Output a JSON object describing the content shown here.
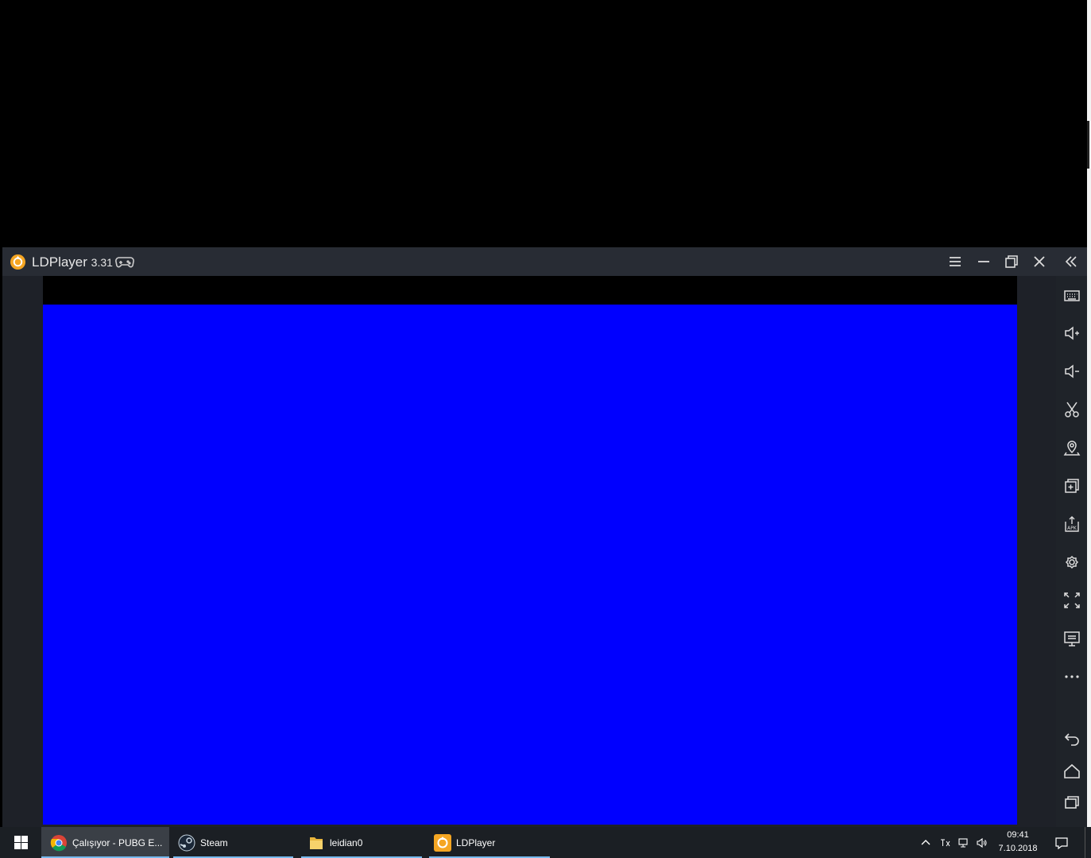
{
  "window": {
    "app_name": "LDPlayer",
    "version": "3.31",
    "menu_icon": "hamburger-icon",
    "minimize_icon": "minimize-icon",
    "restore_icon": "restore-icon",
    "close_icon": "close-icon",
    "collapse_icon": "double-chevron-left-icon"
  },
  "screen": {
    "content_color": "#0000ff",
    "letterbox_color": "#000000"
  },
  "side_toolbar": {
    "items": [
      "keyboard-icon",
      "volume-up-icon",
      "volume-down-icon",
      "screenshot-scissors-icon",
      "location-icon",
      "multi-instance-icon",
      "install-apk-icon",
      "settings-icon",
      "fullscreen-icon",
      "display-icon",
      "more-icon",
      "back-icon",
      "home-icon",
      "recent-apps-icon"
    ]
  },
  "taskbar": {
    "items": [
      {
        "label": "Çalışıyor - PUBG E...",
        "icon": "chrome-icon"
      },
      {
        "label": "Steam",
        "icon": "steam-icon"
      },
      {
        "label": "leidian0",
        "icon": "folder-icon"
      },
      {
        "label": "LDPlayer",
        "icon": "ldplayer-icon"
      }
    ],
    "clock": {
      "time": "09:41",
      "date": "7.10.2018"
    }
  },
  "colors": {
    "titlebar": "#282c34",
    "toolbar": "#1f2329",
    "taskbar": "#1b1f24",
    "accent": "#76b9ed",
    "brand": "#f5a623"
  }
}
